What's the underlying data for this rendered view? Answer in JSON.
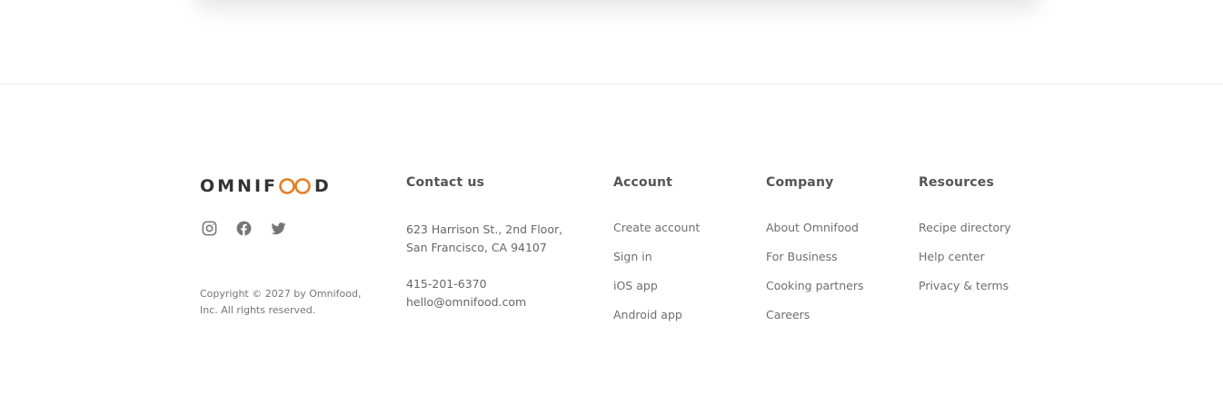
{
  "logo": {
    "left": "OMNIF",
    "right": "D",
    "alt": "Omnifood logo"
  },
  "socials": [
    {
      "name": "instagram-icon"
    },
    {
      "name": "facebook-icon"
    },
    {
      "name": "twitter-icon"
    }
  ],
  "copyright": "Copyright © 2027 by Omnifood, Inc. All rights reserved.",
  "contact": {
    "heading": "Contact us",
    "address_line1": "623 Harrison St., 2nd Floor,",
    "address_line2": "San Francisco, CA 94107",
    "phone": "415-201-6370",
    "email": "hello@omnifood.com"
  },
  "account": {
    "heading": "Account",
    "links": [
      "Create account",
      "Sign in",
      "iOS app",
      "Android app"
    ]
  },
  "company": {
    "heading": "Company",
    "links": [
      "About Omnifood",
      "For Business",
      "Cooking partners",
      "Careers"
    ]
  },
  "resources": {
    "heading": "Resources",
    "links": [
      "Recipe directory",
      "Help center",
      "Privacy & terms"
    ]
  },
  "colors": {
    "accent": "#e67e22",
    "text": "#555555",
    "border": "#eeeeee"
  }
}
